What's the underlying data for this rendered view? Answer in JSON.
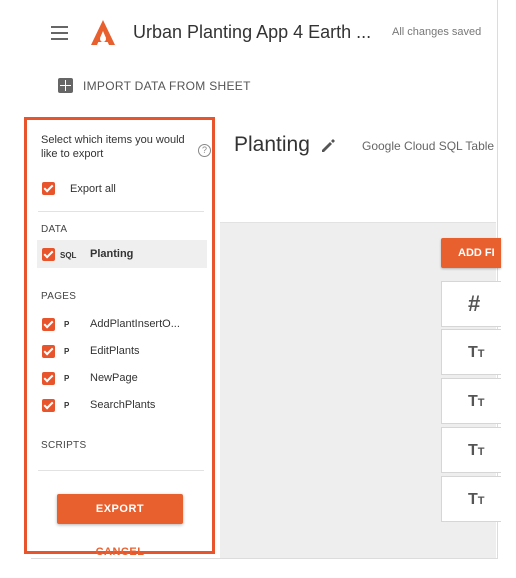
{
  "header": {
    "app_title": "Urban Planting App 4 Earth ...",
    "save_status": "All changes saved",
    "brand_color": "#e9602f"
  },
  "toolbar": {
    "import_label": "IMPORT DATA FROM SHEET"
  },
  "main": {
    "page_title": "Planting",
    "table_type": "Google Cloud SQL Table",
    "add_field_label": "ADD FI",
    "field_cards": [
      "#",
      "TT",
      "TT",
      "TT",
      "TT"
    ]
  },
  "export_panel": {
    "question": "Select which items you would like to export",
    "export_all_label": "Export all",
    "sections": {
      "data": "DATA",
      "pages": "PAGES",
      "scripts": "SCRIPTS"
    },
    "data_items": [
      {
        "tag": "SQL",
        "label": "Planting",
        "checked": true
      }
    ],
    "page_items": [
      {
        "tag": "P",
        "label": "AddPlantInsertO...",
        "checked": true
      },
      {
        "tag": "P",
        "label": "EditPlants",
        "checked": true
      },
      {
        "tag": "P",
        "label": "NewPage",
        "checked": true
      },
      {
        "tag": "P",
        "label": "SearchPlants",
        "checked": true
      }
    ],
    "export_button": "EXPORT",
    "cancel_button": "CANCEL",
    "highlight_color": "#e8552c"
  }
}
